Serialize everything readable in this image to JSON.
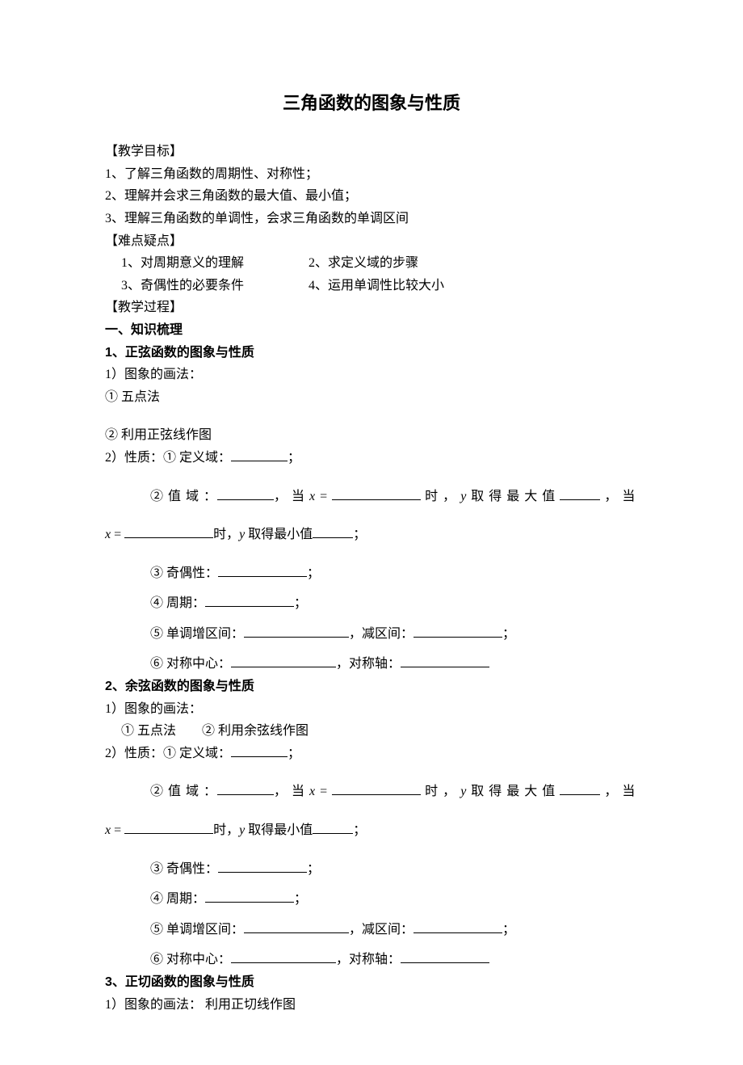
{
  "title": "三角函数的图象与性质",
  "labels": {
    "goals": "【教学目标】",
    "difficulties": "【难点疑点】",
    "process": "【教学过程】",
    "outline": "一、知识梳理"
  },
  "goals": {
    "g1": "1、了解三角函数的周期性、对称性；",
    "g2": "2、理解并会求三角函数的最大值、最小值；",
    "g3": "3、理解三角函数的单调性，会求三角函数的单调区间"
  },
  "difficulties": {
    "d1": "1、对周期意义的理解",
    "d2": "2、求定义域的步骤",
    "d3": "3、奇偶性的必要条件",
    "d4": "4、运用单调性比较大小"
  },
  "s1": {
    "heading": "1、正弦函数的图象与性质",
    "m1": "1）图象的画法：",
    "m1a": "① 五点法",
    "m1b": "② 利用正弦线作图",
    "m2_prefix": "2）性质：① 定义域：",
    "m2_suffix": "；",
    "p2_pref": "②  值 域 ：",
    "p2_mid1": "， 当 ",
    "p2_x": "x",
    "p2_eq": " = ",
    "p2_mid2": " 时 ， ",
    "p2_y": "y",
    "p2_mid3": " 取 得 最 大 值 ",
    "p2_mid4": " ， 当",
    "p2b_x": "x",
    "p2b_eq": " = ",
    "p2b_mid1": "时，",
    "p2b_y": "y",
    "p2b_mid2": " 取得最小值",
    "p2b_suffix": "；",
    "p3": "③ 奇偶性：",
    "p3_suffix": "；",
    "p4": "④ 周期：",
    "p4_suffix": "；",
    "p5a": "⑤ 单调增区间：",
    "p5b": "，减区间：",
    "p5_suffix": "；",
    "p6a": "⑥ 对称中心：",
    "p6b": "，对称轴："
  },
  "s2": {
    "heading": "2、余弦函数的图象与性质",
    "m1": "1）图象的画法：",
    "m1ab": "① 五点法  ② 利用余弦线作图",
    "m2_prefix": "2）性质：① 定义域：",
    "m2_suffix": "；",
    "p2_pref": "②  值 域 ：",
    "p2_mid1": "， 当 ",
    "p2_x": "x",
    "p2_eq": " = ",
    "p2_mid2": " 时 ， ",
    "p2_y": "y",
    "p2_mid3": " 取 得 最 大 值 ",
    "p2_mid4": " ， 当",
    "p2b_x": "x",
    "p2b_eq": " = ",
    "p2b_mid1": "时，",
    "p2b_y": "y",
    "p2b_mid2": " 取得最小值",
    "p2b_suffix": "；",
    "p3": "③ 奇偶性：",
    "p3_suffix": "；",
    "p4": "④ 周期：",
    "p4_suffix": "；",
    "p5a": "⑤ 单调增区间：",
    "p5b": "，减区间：",
    "p5_suffix": "；",
    "p6a": "⑥ 对称中心：",
    "p6b": "，对称轴："
  },
  "s3": {
    "heading": "3、正切函数的图象与性质",
    "m1": "1）图象的画法：  利用正切线作图"
  }
}
